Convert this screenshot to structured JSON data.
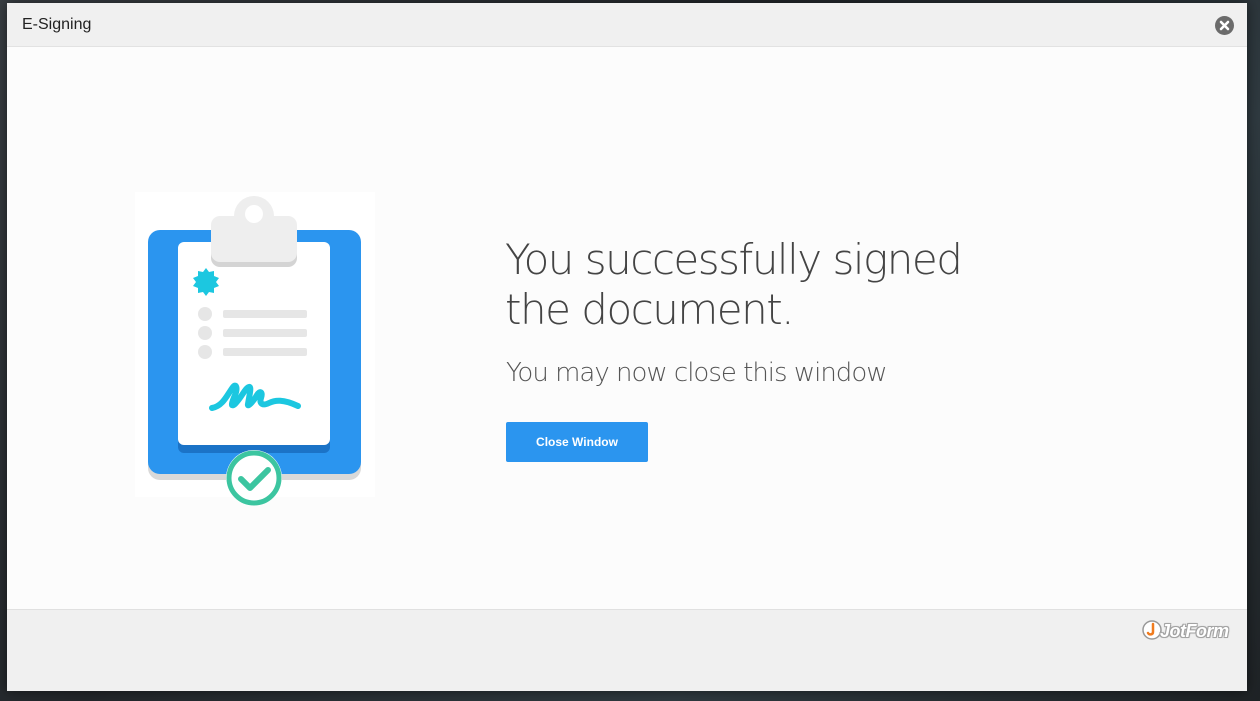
{
  "window": {
    "title": "E-Signing"
  },
  "message": {
    "headline": "You successfully signed the document.",
    "subline": "You may now close this window"
  },
  "actions": {
    "close_label": "Close Window"
  },
  "footer": {
    "brand": "JotForm"
  },
  "icons": {
    "close": "close-circle-icon",
    "illustration": "clipboard-signed-document-icon",
    "check": "checkmark-circle-icon",
    "brand": "jotform-logo-icon"
  },
  "colors": {
    "accent": "#2b95ef",
    "clipboard": "#2b95ef",
    "seal": "#1cc7e0",
    "signature": "#1cc7e0",
    "check": "#3cc5a0",
    "titlebar": "#f0f0f0"
  }
}
